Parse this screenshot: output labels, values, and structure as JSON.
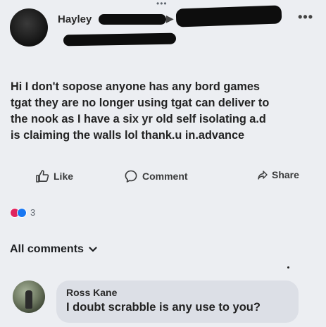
{
  "post": {
    "author": "Hayley",
    "text": "Hi I don't sopose anyone has any bord games\ntgat they are no longer using tgat can deliver to\nthe nook as I have a six yr old self isolating a.d\nis claiming the walls lol  thank.u in.advance",
    "more_menu": "•••"
  },
  "actions": {
    "like": "Like",
    "comment": "Comment",
    "share": "Share"
  },
  "reactions": {
    "count": "3",
    "types": [
      "love",
      "like"
    ]
  },
  "comments_section": {
    "filter_label": "All comments"
  },
  "comments": [
    {
      "author": "Ross Kane",
      "text": "I doubt scrabble is any use to you?"
    }
  ],
  "colors": {
    "background": "#eceef2",
    "comment_bubble": "#dcdfe6",
    "love_reaction": "#e0245e",
    "like_reaction": "#1877f2",
    "redaction": "#0d0d0d"
  },
  "icons": {
    "like": "thumbs-up-icon",
    "comment": "speech-bubble-icon",
    "share": "share-icon",
    "more": "more-dots-icon",
    "filter": "chevron-down-icon"
  }
}
